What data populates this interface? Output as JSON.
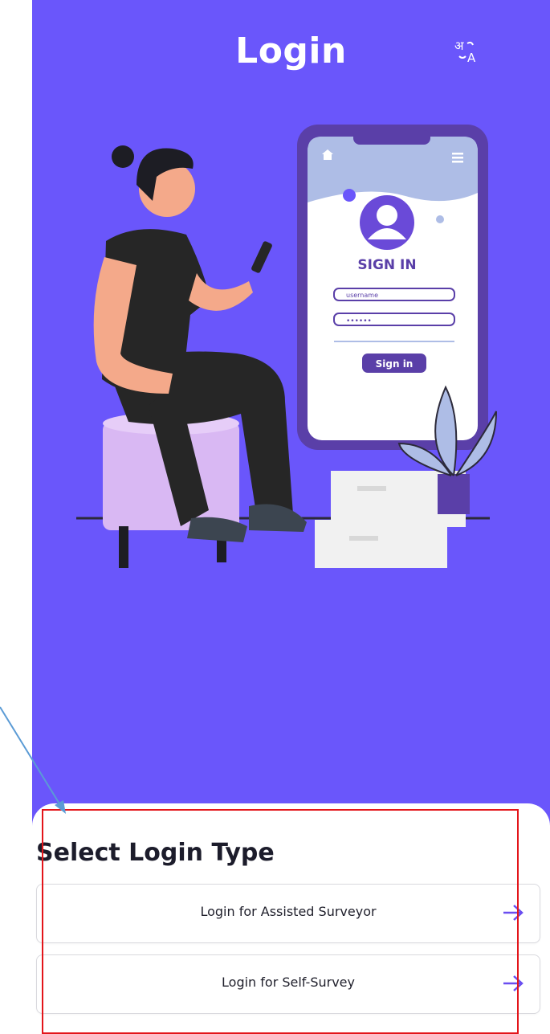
{
  "header": {
    "title": "Login",
    "language_icon": "translate-icon"
  },
  "illustration": {
    "phone_heading": "SIGN IN",
    "username_placeholder": "username",
    "password_mask": "••••••",
    "sign_in_label": "Sign in"
  },
  "sheet": {
    "title": "Select Login Type",
    "options": [
      {
        "label": "Login for Assisted Surveyor",
        "icon": "arrow-right-icon"
      },
      {
        "label": "Login for Self-Survey",
        "icon": "arrow-right-icon"
      }
    ]
  },
  "colors": {
    "brand": "#6a56fb",
    "accent": "#6a4ef0",
    "highlight": "#e3151a"
  }
}
